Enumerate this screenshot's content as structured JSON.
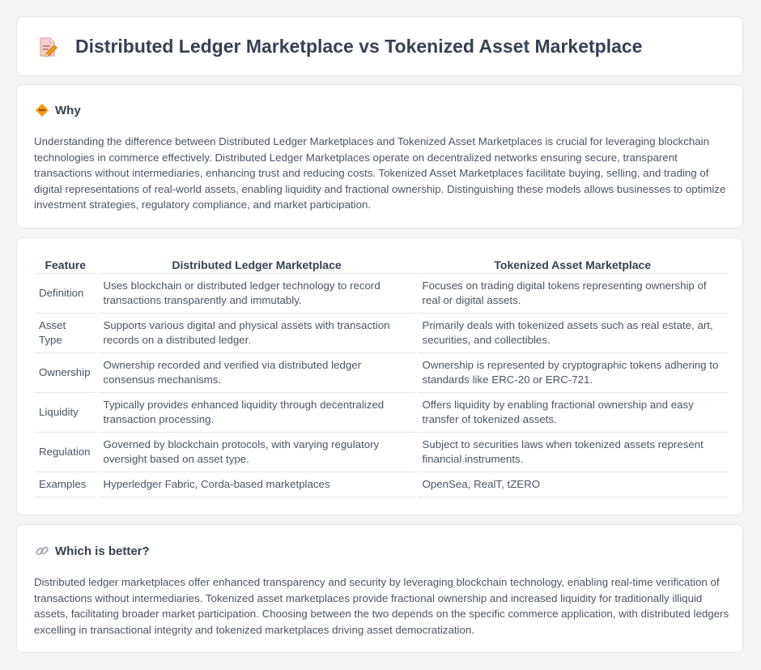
{
  "header": {
    "title": "Distributed Ledger Marketplace vs Tokenized Asset Marketplace",
    "icon": "edit-document-icon"
  },
  "why": {
    "title": "Why",
    "icon": "diamond-warning-icon",
    "text": "Understanding the difference between Distributed Ledger Marketplaces and Tokenized Asset Marketplaces is crucial for leveraging blockchain technologies in commerce effectively. Distributed Ledger Marketplaces operate on decentralized networks ensuring secure, transparent transactions without intermediaries, enhancing trust and reducing costs. Tokenized Asset Marketplaces facilitate buying, selling, and trading of digital representations of real-world assets, enabling liquidity and fractional ownership. Distinguishing these models allows businesses to optimize investment strategies, regulatory compliance, and market participation."
  },
  "table": {
    "headers": [
      "Feature",
      "Distributed Ledger Marketplace",
      "Tokenized Asset Marketplace"
    ],
    "rows": [
      [
        "Definition",
        "Uses blockchain or distributed ledger technology to record transactions transparently and immutably.",
        "Focuses on trading digital tokens representing ownership of real or digital assets."
      ],
      [
        "Asset Type",
        "Supports various digital and physical assets with transaction records on a distributed ledger.",
        "Primarily deals with tokenized assets such as real estate, art, securities, and collectibles."
      ],
      [
        "Ownership",
        "Ownership recorded and verified via distributed ledger consensus mechanisms.",
        "Ownership is represented by cryptographic tokens adhering to standards like ERC-20 or ERC-721."
      ],
      [
        "Liquidity",
        "Typically provides enhanced liquidity through decentralized transaction processing.",
        "Offers liquidity by enabling fractional ownership and easy transfer of tokenized assets."
      ],
      [
        "Regulation",
        "Governed by blockchain protocols, with varying regulatory oversight based on asset type.",
        "Subject to securities laws when tokenized assets represent financial instruments."
      ],
      [
        "Examples",
        "Hyperledger Fabric, Corda-based marketplaces",
        "OpenSea, RealT, tZERO"
      ]
    ]
  },
  "better": {
    "title": "Which is better?",
    "icon": "link-icon",
    "text": "Distributed ledger marketplaces offer enhanced transparency and security by leveraging blockchain technology, enabling real-time verification of transactions without intermediaries. Tokenized asset marketplaces provide fractional ownership and increased liquidity for traditionally illiquid assets, facilitating broader market participation. Choosing between the two depends on the specific commerce application, with distributed ledgers excelling in transactional integrity and tokenized marketplaces driving asset democratization."
  },
  "colors": {
    "page_background": "#f3f4f6",
    "card_background": "#ffffff",
    "heading_text": "#374151",
    "body_text": "#4b5563",
    "icon_accent": "#f59e0b"
  }
}
